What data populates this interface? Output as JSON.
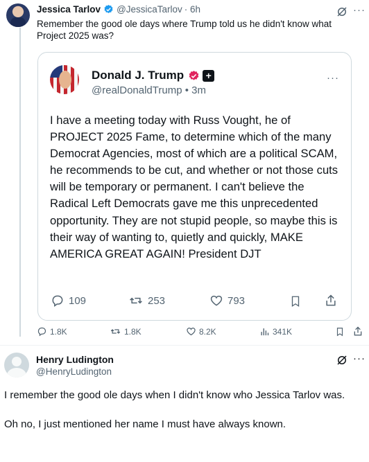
{
  "tweet": {
    "author_name": "Jessica Tarlov",
    "author_handle": "@JessicaTarlov",
    "time": "· 6h",
    "text": "Remember the good ole days where Trump told us he didn't know what Project 2025 was?",
    "stats": {
      "replies": "1.8K",
      "reposts": "1.8K",
      "likes": "8.2K",
      "views": "341K"
    }
  },
  "quoted_post": {
    "author_name": "Donald J. Trump",
    "author_handle": "@realDonaldTrump",
    "time": "• 3m",
    "badge_symbol": "+",
    "text": "I have a meeting today with Russ Vought, he of PROJECT 2025 Fame, to determine which of the many Democrat Agencies, most of which are a political SCAM, he recommends to be cut, and whether or not those cuts will be temporary or permanent. I can't believe the Radical Left Democrats gave me this unprecedented opportunity. They are not stupid people, so maybe this is their way of wanting to, quietly and quickly, MAKE AMERICA GREAT AGAIN! President DJT",
    "stats": {
      "replies": "109",
      "restruths": "253",
      "likes": "793"
    }
  },
  "reply": {
    "author_name": "Henry Ludington",
    "author_handle": "@HenryLudington",
    "paragraphs": [
      "I remember the good ole days when I didn't know who Jessica Tarlov was.",
      "Oh no, I just mentioned her name I must have always known."
    ]
  },
  "icons": {
    "more": "more-icon",
    "grok": "grok-icon",
    "verified": "verified-badge-icon",
    "reply": "reply-icon",
    "repost": "repost-icon",
    "like": "heart-icon",
    "views": "views-icon",
    "bookmark": "bookmark-icon",
    "share": "share-icon"
  },
  "colors": {
    "verified_blue": "#1d9bf0",
    "trump_badge_red": "#e0245e",
    "text_primary": "#0f1419",
    "text_secondary": "#536471",
    "border": "#cfd9de"
  }
}
